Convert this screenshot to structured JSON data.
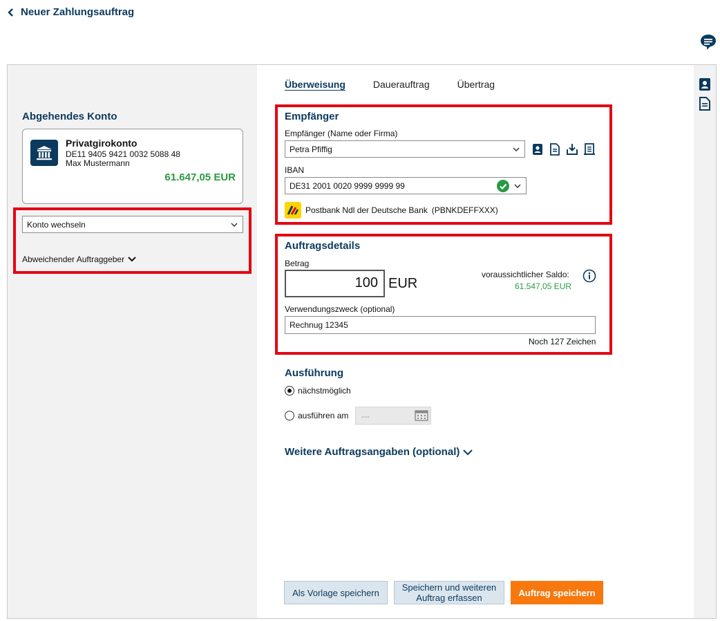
{
  "header": {
    "back_title": "Neuer Zahlungsauftrag"
  },
  "left": {
    "section_title": "Abgehendes Konto",
    "account": {
      "name": "Privatgirokonto",
      "iban": "DE11 9405 9421 0032 5088 48",
      "holder": "Max Mustermann",
      "balance": "61.647,05 EUR"
    },
    "switch_account_label": "Konto wechseln",
    "alt_orderer_label": "Abweichender Auftraggeber"
  },
  "tabs": [
    {
      "label": "Überweisung",
      "active": true
    },
    {
      "label": "Dauerauftrag",
      "active": false
    },
    {
      "label": "Übertrag",
      "active": false
    }
  ],
  "recipient": {
    "section_title": "Empfänger",
    "name_label": "Empfänger (Name oder Firma)",
    "name_value": "Petra Pfiffig",
    "iban_label": "IBAN",
    "iban_value": "DE31 2001 0020 9999 9999 99",
    "bank_name": "Postbank Ndl der Deutsche Bank",
    "bic": "(PBNKDEFFXXX)",
    "action_icons": [
      "contact-book-icon",
      "document-icon",
      "download-icon",
      "receipt-icon"
    ]
  },
  "order": {
    "section_title": "Auftragsdetails",
    "amount_label": "Betrag",
    "amount_value": "100",
    "currency": "EUR",
    "saldo_label": "voraussichtlicher Saldo:",
    "saldo_value": "61.547,05 EUR",
    "purpose_label": "Verwendungszweck (optional)",
    "purpose_value": "Rechnug 12345",
    "chars_left": "Noch 127 Zeichen"
  },
  "execution": {
    "section_title": "Ausführung",
    "option_asap": "nächstmöglich",
    "option_date": "ausführen am",
    "date_placeholder": "---",
    "selected": "asap"
  },
  "more_details_label": "Weitere Auftragsangaben (optional)",
  "buttons": {
    "save_template": "Als Vorlage speichern",
    "save_and_next_line1": "Speichern und weiteren",
    "save_and_next_line2": "Auftrag erfassen",
    "save_order": "Auftrag speichern"
  },
  "colors": {
    "brand_navy": "#0b3a5e",
    "accent_orange": "#f7780f",
    "positive_green": "#2a9a42",
    "highlight_red": "#e30613"
  }
}
